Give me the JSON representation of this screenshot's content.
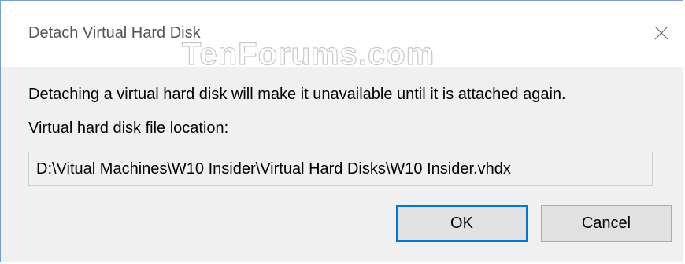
{
  "dialog": {
    "title": "Detach Virtual Hard Disk",
    "watermark": "TenForums.com",
    "message": "Detaching a virtual hard disk will make it unavailable until it is attached again.",
    "location_label": "Virtual hard disk file location:",
    "location_value": "D:\\Vitual Machines\\W10 Insider\\Virtual Hard Disks\\W10 Insider.vhdx",
    "ok_label": "OK",
    "cancel_label": "Cancel",
    "close_icon": "close-icon"
  },
  "colors": {
    "accent": "#0078d7",
    "dialog_bg": "#f0f0f0",
    "border": "#7a9cc0"
  }
}
